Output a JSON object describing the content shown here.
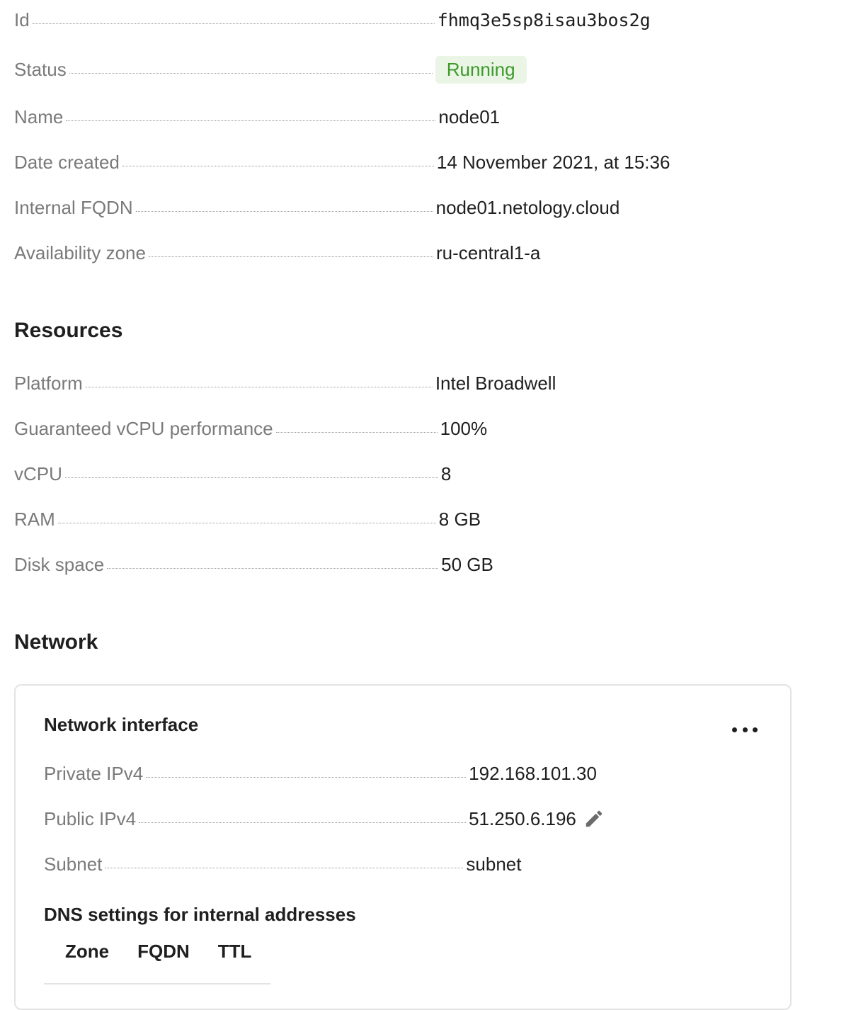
{
  "general": {
    "id": {
      "label": "Id",
      "value": "fhmq3e5sp8isau3bos2g"
    },
    "status": {
      "label": "Status",
      "value": "Running"
    },
    "name": {
      "label": "Name",
      "value": "node01"
    },
    "date_created": {
      "label": "Date created",
      "value": "14 November 2021, at 15:36"
    },
    "internal_fqdn": {
      "label": "Internal FQDN",
      "value": "node01.netology.cloud"
    },
    "availability_zone": {
      "label": "Availability zone",
      "value": "ru-central1-a"
    }
  },
  "resources": {
    "title": "Resources",
    "platform": {
      "label": "Platform",
      "value": "Intel Broadwell"
    },
    "guaranteed_vcpu": {
      "label": "Guaranteed vCPU performance",
      "value": "100%"
    },
    "vcpu": {
      "label": "vCPU",
      "value": "8"
    },
    "ram": {
      "label": "RAM",
      "value": "8 GB"
    },
    "disk_space": {
      "label": "Disk space",
      "value": "50 GB"
    }
  },
  "network": {
    "title": "Network",
    "interface_title": "Network interface",
    "more_icon": "more-horizontal-icon",
    "private_ipv4": {
      "label": "Private IPv4",
      "value": "192.168.101.30"
    },
    "public_ipv4": {
      "label": "Public IPv4",
      "value": "51.250.6.196",
      "edit_icon": "pencil-icon"
    },
    "subnet": {
      "label": "Subnet",
      "value": "subnet"
    },
    "dns_title": "DNS settings for internal addresses",
    "dns_columns": [
      "Zone",
      "FQDN",
      "TTL"
    ]
  },
  "colors": {
    "status_running_text": "#3c9a29",
    "status_running_bg": "#eaf5e6",
    "link": "#2a7de1",
    "label": "#7a7a7a"
  }
}
